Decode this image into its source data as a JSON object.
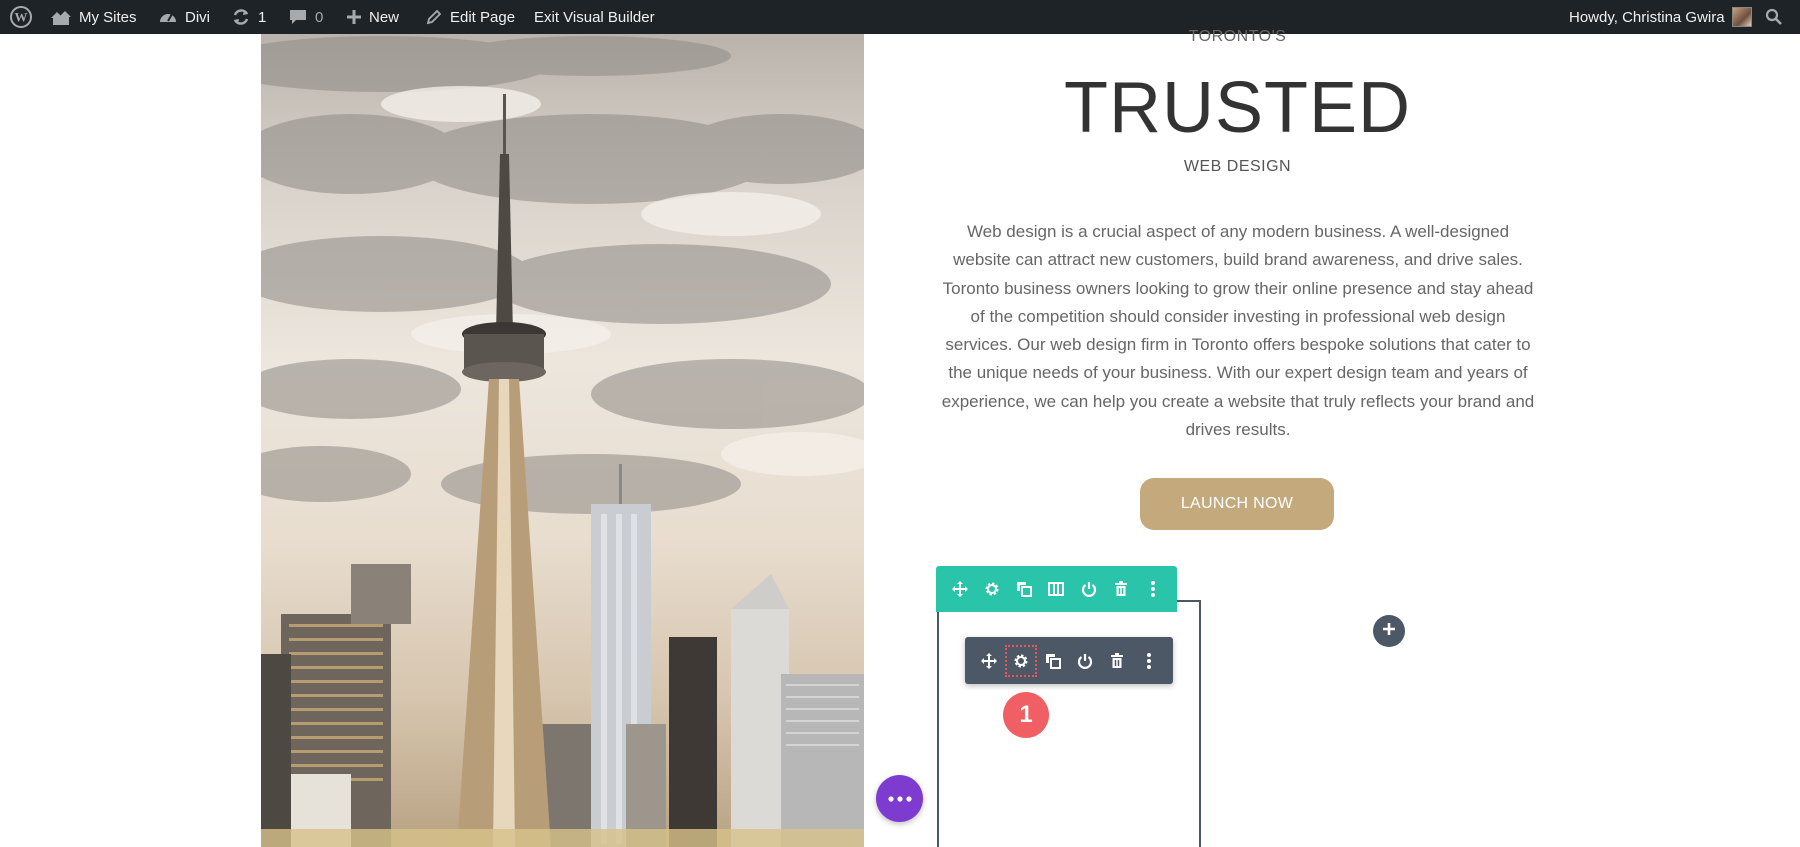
{
  "admin_bar": {
    "my_sites": "My Sites",
    "divi": "Divi",
    "updates_count": "1",
    "comments_count": "0",
    "new": "New",
    "edit_page": "Edit Page",
    "exit_builder": "Exit Visual Builder",
    "howdy": "Howdy, Christina Gwira"
  },
  "hero": {
    "kicker": "TORONTO'S",
    "headline": "TRUSTED",
    "subhead": "WEB DESIGN",
    "body": "Web design is a crucial aspect of any modern business. A well-designed website can attract new customers, build brand awareness, and drive sales. Toronto business owners looking to grow their online presence and stay ahead of the competition should consider investing in professional web design services. Our web design firm in Toronto offers bespoke solutions that cater to the unique needs of your business. With our expert design team and years of experience, we can help you create a website that truly reflects your brand and drives results.",
    "button": "LAUNCH NOW"
  },
  "builder": {
    "callout_number": "1"
  },
  "colors": {
    "admin_bar_bg": "#1d2327",
    "row_toolbar": "#29c4a9",
    "module_toolbar": "#4c5866",
    "button_bg": "#c3a97c",
    "callout": "#ef5f63",
    "page_options": "#7e3bd0"
  },
  "icons": {
    "admin_bar": [
      "wordpress-icon",
      "my-sites-icon",
      "dashboard-icon",
      "updates-icon",
      "comments-icon",
      "plus-icon",
      "pencil-icon",
      "search-icon"
    ],
    "row_toolbar": [
      "move-icon",
      "gear-icon",
      "duplicate-icon",
      "columns-icon",
      "power-icon",
      "trash-icon",
      "more-vertical-icon"
    ],
    "module_toolbar": [
      "move-icon",
      "gear-icon",
      "duplicate-icon",
      "power-icon",
      "trash-icon",
      "more-vertical-icon"
    ]
  }
}
